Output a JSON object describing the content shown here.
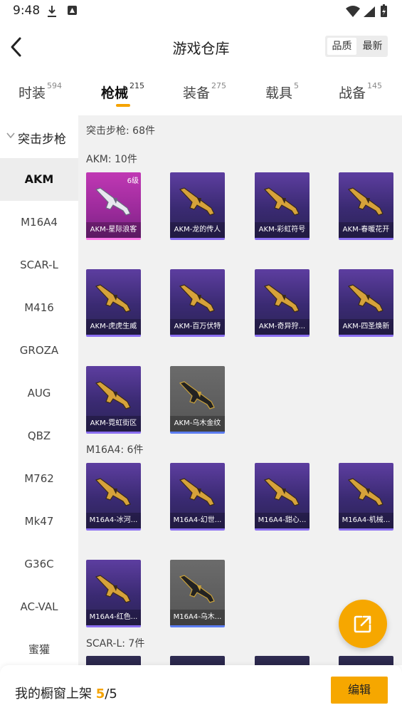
{
  "status": {
    "time": "9:48"
  },
  "header": {
    "title": "游戏仓库",
    "sort_quality": "品质",
    "sort_latest": "最新"
  },
  "tabs": [
    {
      "label": "时装",
      "count": "594"
    },
    {
      "label": "枪械",
      "count": "215"
    },
    {
      "label": "装备",
      "count": "275"
    },
    {
      "label": "载具",
      "count": "5"
    },
    {
      "label": "战备",
      "count": "145"
    }
  ],
  "sidebar": {
    "category": "突击步枪",
    "items": [
      "AKM",
      "M16A4",
      "SCAR-L",
      "M416",
      "GROZA",
      "AUG",
      "QBZ",
      "M762",
      "Mk47",
      "G36C",
      "AC-VAL",
      "蜜獾"
    ]
  },
  "content": {
    "section_title": "突击步枪: 68件",
    "groups": [
      {
        "title": "AKM: 10件",
        "items": [
          {
            "name": "AKM-星际浪客",
            "level": "6级",
            "style": "pink"
          },
          {
            "name": "AKM-龙的传人",
            "style": "purple"
          },
          {
            "name": "AKM-彩虹符号",
            "style": "purple"
          },
          {
            "name": "AKM-春暖花开",
            "style": "purple"
          },
          {
            "name": "AKM-虎虎生威",
            "style": "purple"
          },
          {
            "name": "AKM-百万伏特",
            "style": "purple"
          },
          {
            "name": "AKM-奇异狩...",
            "style": "purple"
          },
          {
            "name": "AKM-四圣焕新",
            "style": "purple"
          },
          {
            "name": "AKM-霓虹街区",
            "style": "purple"
          },
          {
            "name": "AKM-乌木金纹",
            "style": "gray"
          }
        ]
      },
      {
        "title": "M16A4: 6件",
        "items": [
          {
            "name": "M16A4-冰河...",
            "style": "purple"
          },
          {
            "name": "M16A4-幻世...",
            "style": "purple"
          },
          {
            "name": "M16A4-甜心...",
            "style": "purple"
          },
          {
            "name": "M16A4-机械...",
            "style": "purple"
          },
          {
            "name": "M16A4-红色...",
            "style": "purple"
          },
          {
            "name": "M16A4-乌木...",
            "style": "gray"
          }
        ]
      },
      {
        "title": "SCAR-L: 7件"
      }
    ]
  },
  "bottom": {
    "label": "我的橱窗上架 ",
    "count": "5",
    "sep": "/",
    "total": "5",
    "edit_label": "编辑"
  }
}
